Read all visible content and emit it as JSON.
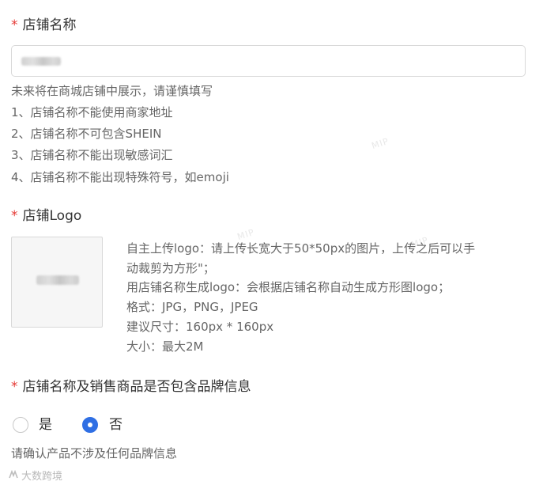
{
  "store_name": {
    "required_mark": "*",
    "label": "店铺名称",
    "help": [
      "未来将在商城店铺中展示，请谨慎填写",
      "1、店铺名称不能使用商家地址",
      "2、店铺名称不可包含SHEIN",
      "3、店铺名称不能出现敏感词汇",
      "4、店铺名称不能出现特殊符号，如emoji"
    ]
  },
  "store_logo": {
    "required_mark": "*",
    "label": "店铺Logo",
    "desc": [
      "自主上传logo：请上传长宽大于50*50px的图片，上传之后可以手",
      "动裁剪为方形\"；",
      "用店铺名称生成logo：会根据店铺名称自动生成方形图logo；",
      "格式：JPG，PNG，JPEG",
      "建议尺寸：160px * 160px",
      "大小：最大2M"
    ]
  },
  "brand_info": {
    "required_mark": "*",
    "label": "店铺名称及销售商品是否包含品牌信息",
    "options": [
      {
        "label": "是",
        "selected": false
      },
      {
        "label": "否",
        "selected": true
      }
    ],
    "note": "请确认产品不涉及任何品牌信息"
  },
  "watermark": {
    "icon": "logo-icon",
    "text": "大数跨境"
  },
  "colors": {
    "required": "#e53935",
    "accent": "#2f6fe4"
  }
}
